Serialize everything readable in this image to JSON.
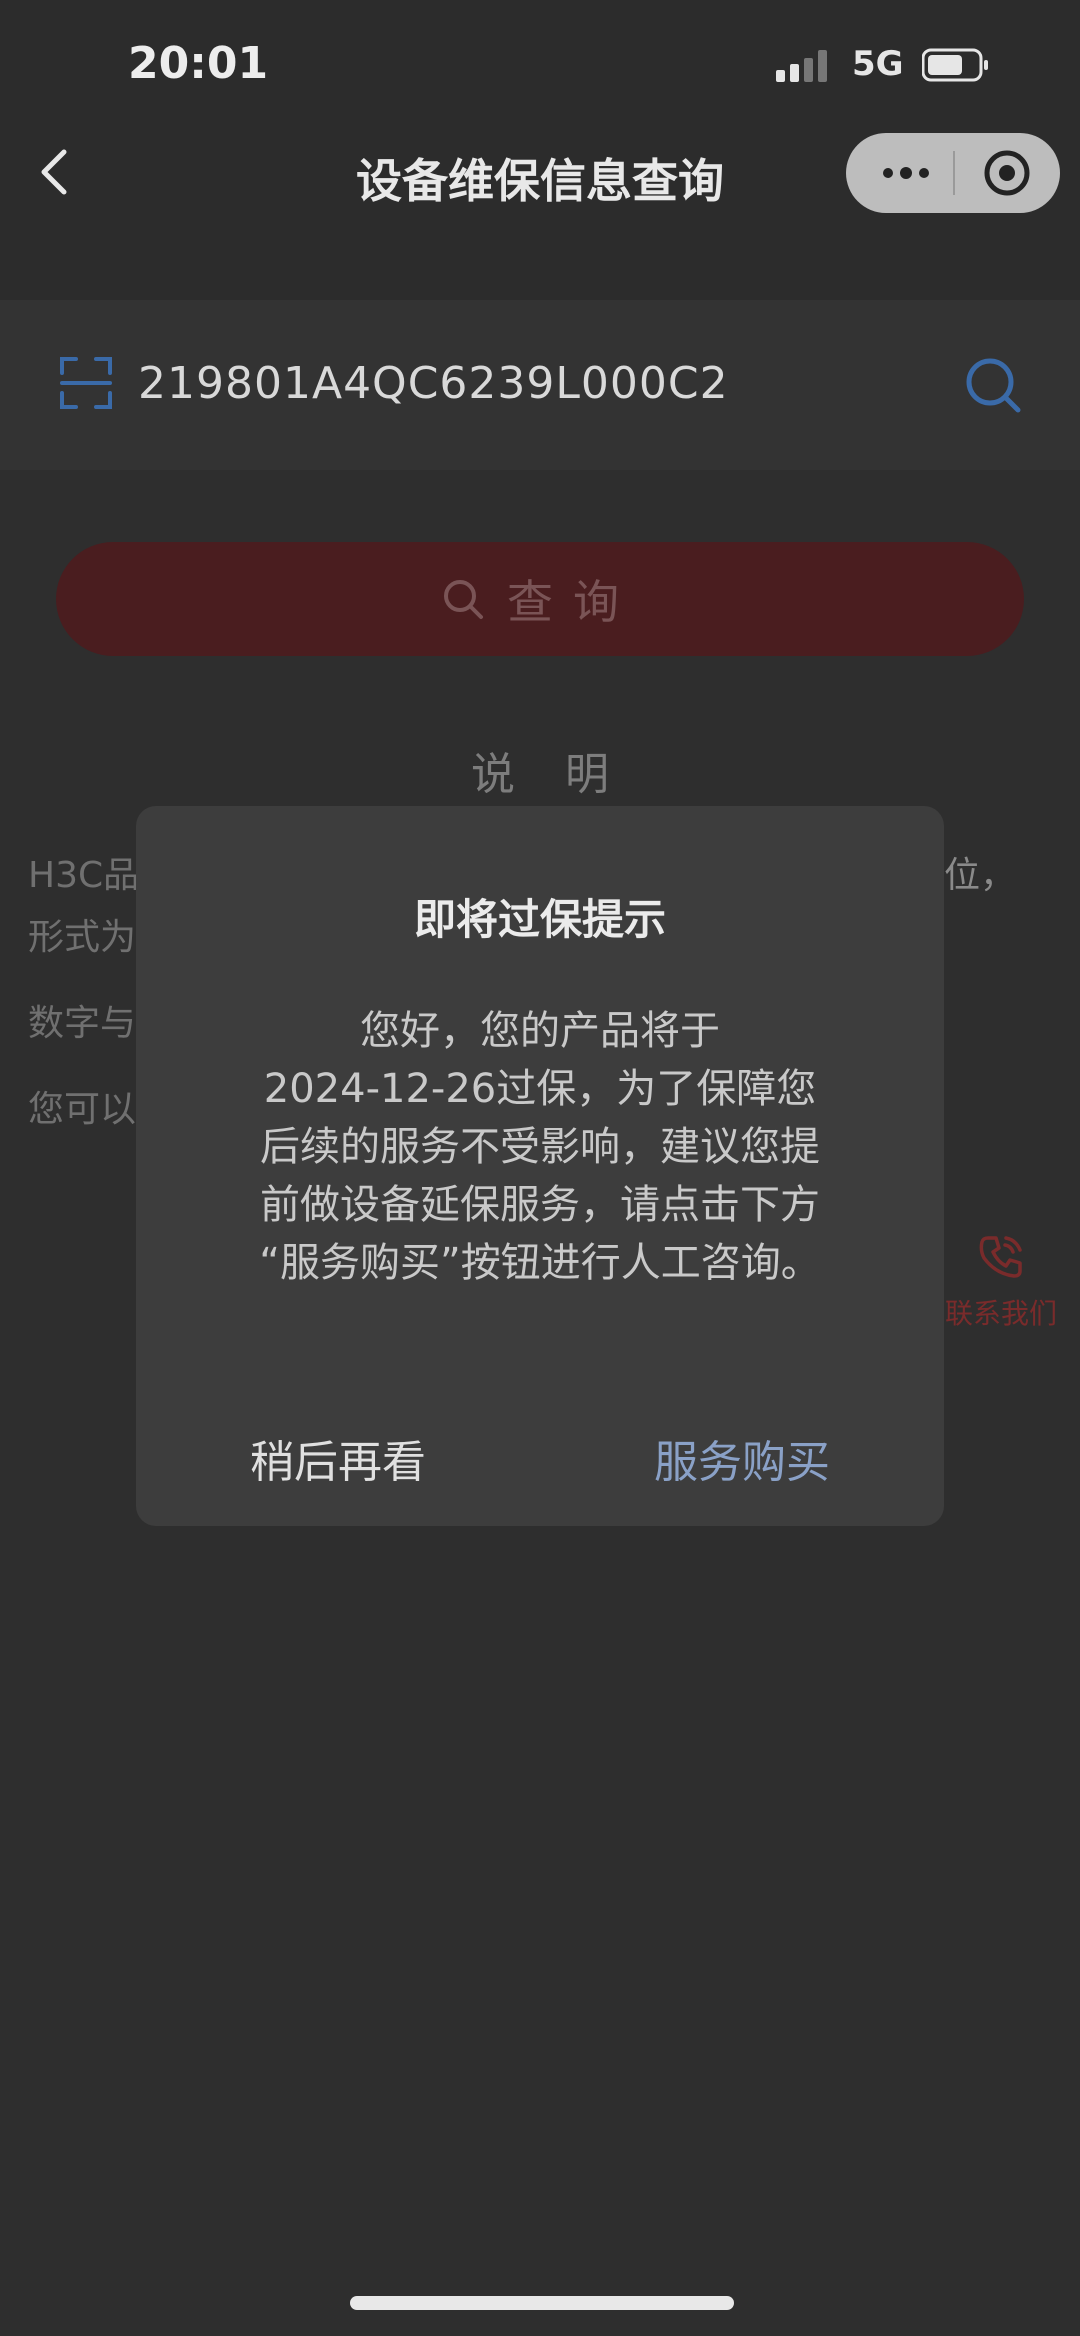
{
  "status_bar": {
    "time": "20:01",
    "network": "5G"
  },
  "nav": {
    "title": "设备维保信息查询"
  },
  "search": {
    "serial_number": "219801A4QC6239L000C2"
  },
  "query_button": {
    "label": "查询"
  },
  "explanation": {
    "title": "说明",
    "line1_start": "H3C品",
    "line1_end": "位，",
    "line2": "形式为",
    "line3": "数字与",
    "line4": "您可以"
  },
  "contact": {
    "label": "联系我们"
  },
  "dialog": {
    "title": "即将过保提示",
    "body_lines": [
      "您好，您的产品将于",
      "2024-12-26过保，为了保障您",
      "后续的服务不受影响，建议您提",
      "前做设备延保服务，请点击下方",
      "“服务购买”按钮进行人工咨询。"
    ],
    "later_label": "稍后再看",
    "buy_label": "服务购买"
  },
  "colors": {
    "accent_red": "#4a1d1f",
    "link_blue": "#8aa1c7",
    "icon_blue": "#3a6aa8"
  },
  "icons": [
    "back-icon",
    "more-icon",
    "target-icon",
    "scan-icon",
    "search-icon",
    "phone-icon"
  ]
}
